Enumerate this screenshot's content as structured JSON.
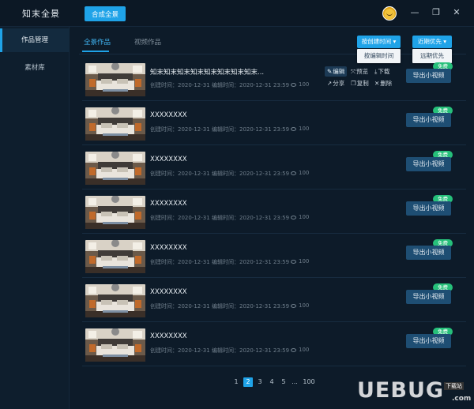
{
  "titlebar": {
    "app_title": "知末全景",
    "synth_button": "合成全景",
    "minimize_glyph": "—",
    "restore_glyph": "❐",
    "close_glyph": "✕"
  },
  "sidebar": {
    "items": [
      {
        "label": "作品管理",
        "active": true
      },
      {
        "label": "素材库",
        "active": false
      }
    ]
  },
  "tabs": [
    {
      "label": "全景作品",
      "active": true
    },
    {
      "label": "视频作品",
      "active": false
    }
  ],
  "sort": {
    "time_button": "按创建时间 ▾",
    "time_option": "按编辑时间",
    "priority_button": "近期优先 ▾",
    "priority_option": "远期优先"
  },
  "actions": {
    "edit": "编辑",
    "preview": "预览",
    "download": "下载",
    "share": "分享",
    "copy": "复制",
    "delete": "删除"
  },
  "works": [
    {
      "title": "知末知末知末知末知末知末知末知末...",
      "created": "创建时间：2020-12-31",
      "edited": "编辑时间：2020-12-31 23:59",
      "views": "100",
      "export": "导出小视频",
      "badge": "免费"
    },
    {
      "title": "XXXXXXXX",
      "created": "创建时间：2020-12-31",
      "edited": "编辑时间：2020-12-31 23:59",
      "views": "100",
      "export": "导出小视频",
      "badge": "免费"
    },
    {
      "title": "XXXXXXXX",
      "created": "创建时间：2020-12-31",
      "edited": "编辑时间：2020-12-31 23:59",
      "views": "100",
      "export": "导出小视频",
      "badge": "免费"
    },
    {
      "title": "XXXXXXXX",
      "created": "创建时间：2020-12-31",
      "edited": "编辑时间：2020-12-31 23:59",
      "views": "100",
      "export": "导出小视频",
      "badge": "免费"
    },
    {
      "title": "XXXXXXXX",
      "created": "创建时间：2020-12-31",
      "edited": "编辑时间：2020-12-31 23:59",
      "views": "100",
      "export": "导出小视频",
      "badge": "免费"
    },
    {
      "title": "XXXXXXXX",
      "created": "创建时间：2020-12-31",
      "edited": "编辑时间：2020-12-31 23:59",
      "views": "100",
      "export": "导出小视频",
      "badge": "免费"
    },
    {
      "title": "XXXXXXXX",
      "created": "创建时间：2020-12-31",
      "edited": "编辑时间：2020-12-31 23:59",
      "views": "100",
      "export": "导出小视频",
      "badge": "免费"
    }
  ],
  "pagination": {
    "pages": [
      "1",
      "2",
      "3",
      "4",
      "5",
      "...",
      "100"
    ],
    "current": "2"
  },
  "watermark": {
    "brand": "UEBUG",
    "tag": "下载站",
    "tld": ".com"
  },
  "colors": {
    "accent": "#1fa3e8",
    "free_badge": "#26c07a",
    "export_button": "#1e4e73",
    "background": "#0d1b29"
  }
}
